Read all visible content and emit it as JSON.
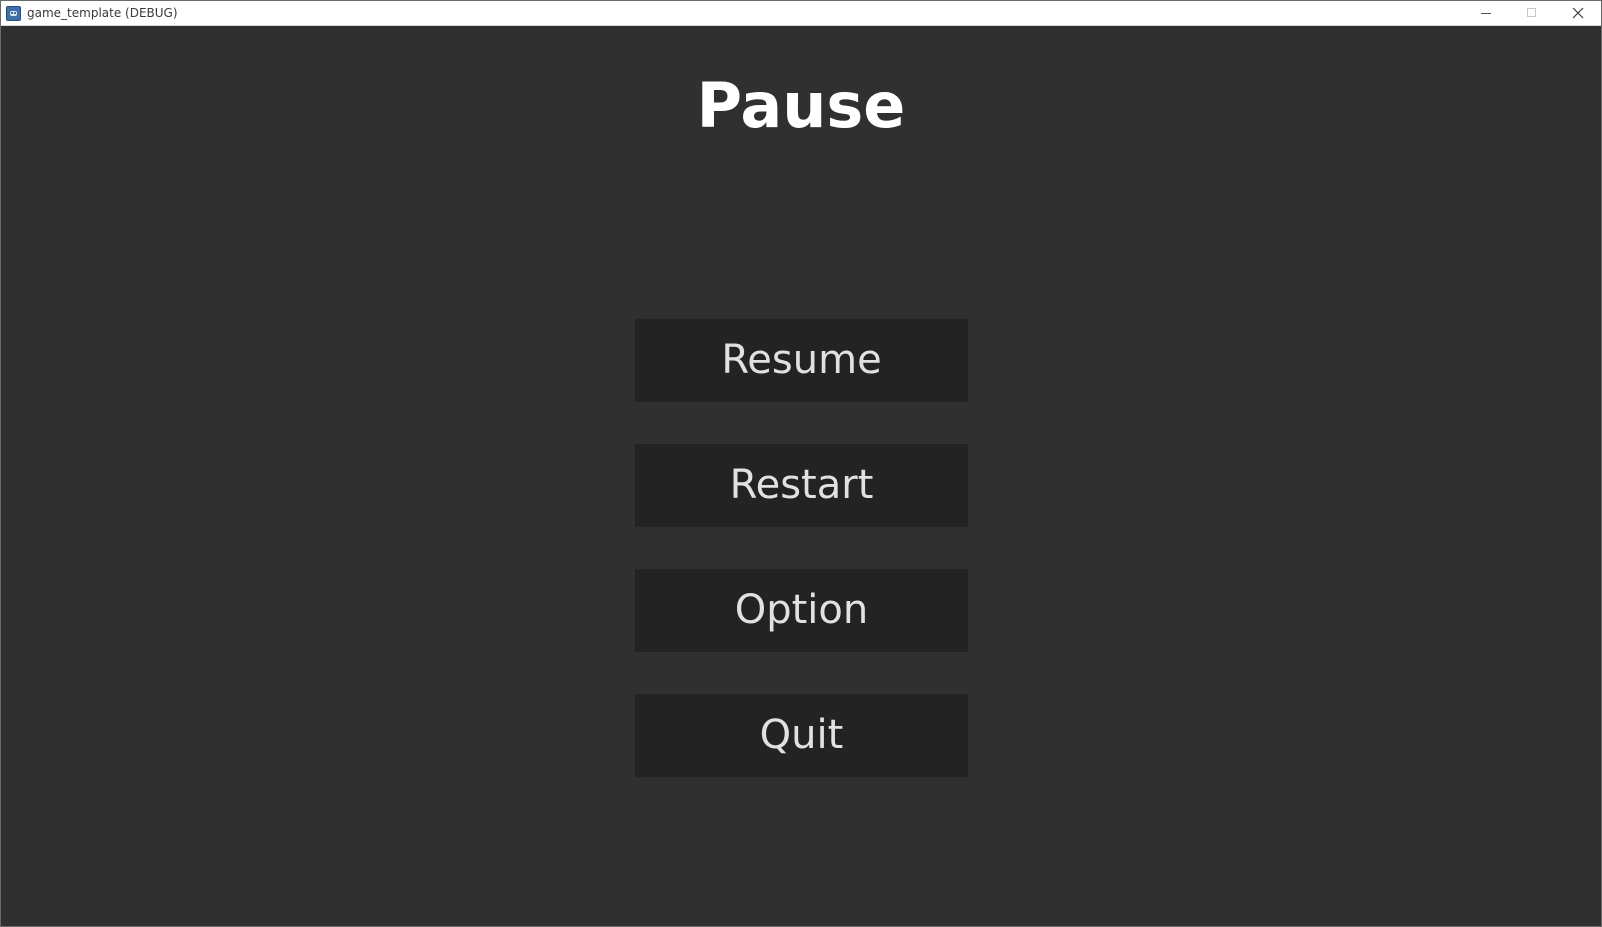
{
  "window": {
    "title": "game_template (DEBUG)",
    "icon": "godot-engine-icon"
  },
  "window_controls": {
    "minimize_icon": "minimize-icon",
    "maximize_icon": "maximize-icon",
    "close_icon": "close-icon"
  },
  "pause_menu": {
    "title": "Pause",
    "buttons": [
      {
        "label": "Resume"
      },
      {
        "label": "Restart"
      },
      {
        "label": "Option"
      },
      {
        "label": "Quit"
      }
    ]
  },
  "colors": {
    "background": "#303030",
    "button_background": "#232323",
    "button_text": "#e1e1e1",
    "title_text": "#ffffff",
    "titlebar": "#ffffff"
  }
}
